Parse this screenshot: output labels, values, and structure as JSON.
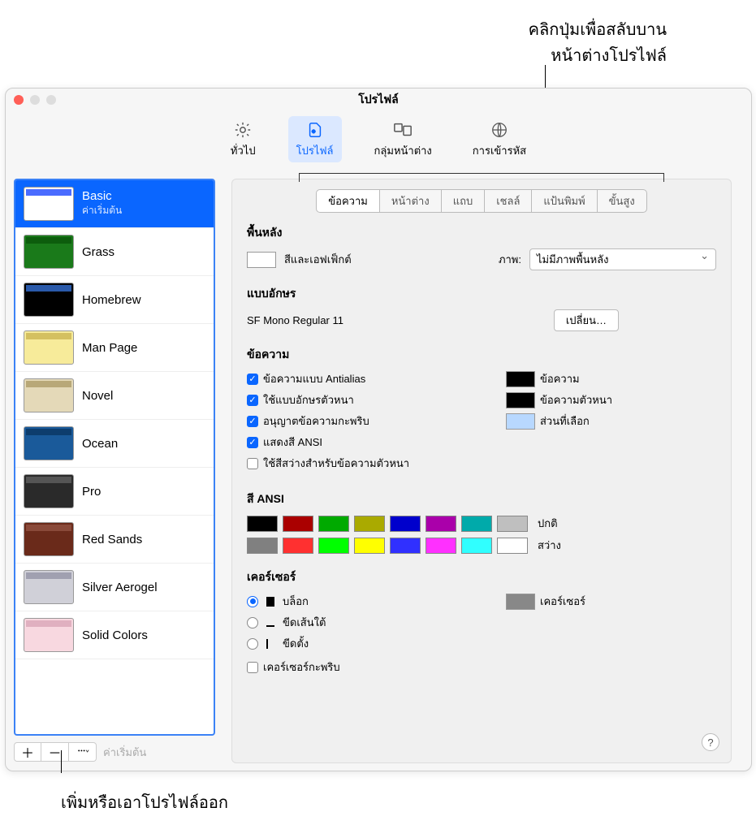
{
  "callouts": {
    "top_line1": "คลิกปุ่มเพื่อสลับบาน",
    "top_line2": "หน้าต่างโปรไฟล์",
    "bottom": "เพิ่มหรือเอาโปรไฟล์ออก"
  },
  "window": {
    "title": "โปรไฟล์"
  },
  "toolbar": {
    "general": "ทั่วไป",
    "profiles": "โปรไฟล์",
    "window_groups": "กลุ่มหน้าต่าง",
    "encodings": "การเข้ารหัส"
  },
  "sidebar": {
    "default_label": "ค่าเริ่มต้น",
    "items": [
      {
        "name": "Basic",
        "sub": "ค่าเริ่มต้น",
        "bg": "#ffffff",
        "bar": "#4a6cff"
      },
      {
        "name": "Grass",
        "sub": "",
        "bg": "#1a7a1a",
        "bar": "#0d5d0d"
      },
      {
        "name": "Homebrew",
        "sub": "",
        "bg": "#000000",
        "bar": "#2a5aaa"
      },
      {
        "name": "Man Page",
        "sub": "",
        "bg": "#f7eb9a",
        "bar": "#d4c060"
      },
      {
        "name": "Novel",
        "sub": "",
        "bg": "#e4d9b8",
        "bar": "#b8a878"
      },
      {
        "name": "Ocean",
        "sub": "",
        "bg": "#1a5a9a",
        "bar": "#0d3d6d"
      },
      {
        "name": "Pro",
        "sub": "",
        "bg": "#2a2a2a",
        "bar": "#555555"
      },
      {
        "name": "Red Sands",
        "sub": "",
        "bg": "#6a2a1a",
        "bar": "#8a4a3a"
      },
      {
        "name": "Silver Aerogel",
        "sub": "",
        "bg": "#d0d0d8",
        "bar": "#a0a0b0"
      },
      {
        "name": "Solid Colors",
        "sub": "",
        "bg": "#f8d8e0",
        "bar": "#e0b0c0"
      }
    ]
  },
  "tabs": [
    "ข้อความ",
    "หน้าต่าง",
    "แถบ",
    "เชลล์",
    "แป้นพิมพ์",
    "ขั้นสูง"
  ],
  "background": {
    "title": "พื้นหลัง",
    "color_effects": "สีและเอฟเฟ็กต์",
    "image_label": "ภาพ:",
    "image_value": "ไม่มีภาพพื้นหลัง"
  },
  "font": {
    "title": "แบบอักษร",
    "value": "SF Mono Regular 11",
    "change": "เปลี่ยน…"
  },
  "text": {
    "title": "ข้อความ",
    "antialias": "ข้อความแบบ Antialias",
    "bold": "ใช้แบบอักษรตัวหนา",
    "blink": "อนุญาตข้อความกะพริบ",
    "ansi": "แสดงสี ANSI",
    "bright_bold": "ใช้สีสว่างสำหรับข้อความตัวหนา",
    "text_color": "ข้อความ",
    "bold_color": "ข้อความตัวหนา",
    "selection_color": "ส่วนที่เลือก"
  },
  "ansi": {
    "title": "สี ANSI",
    "normal": "ปกติ",
    "bright": "สว่าง",
    "normal_colors": [
      "#000000",
      "#aa0000",
      "#00aa00",
      "#aaaa00",
      "#0000cc",
      "#aa00aa",
      "#00aaaa",
      "#bfbfbf"
    ],
    "bright_colors": [
      "#808080",
      "#ff3030",
      "#00ff00",
      "#ffff00",
      "#3030ff",
      "#ff30ff",
      "#30ffff",
      "#ffffff"
    ]
  },
  "cursor": {
    "title": "เคอร์เซอร์",
    "block": "บล็อก",
    "underline": "ขีดเส้นใต้",
    "vertical": "ขีดตั้ง",
    "blink": "เคอร์เซอร์กะพริบ",
    "color_label": "เคอร์เซอร์"
  },
  "text_color_swatches": {
    "text": "#000000",
    "bold": "#000000",
    "selection": "#b8d8ff"
  },
  "cursor_swatch": "#888888"
}
